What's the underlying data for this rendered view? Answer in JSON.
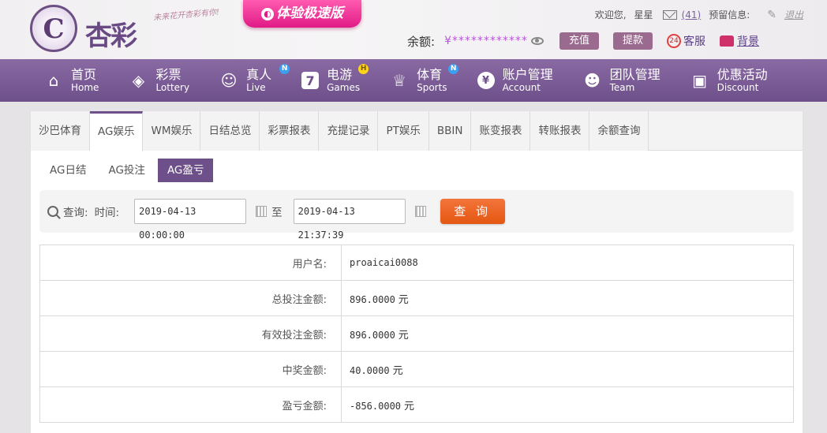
{
  "header": {
    "logo_text": "杏彩",
    "logo_mark": "C",
    "slogan": "未来花开杏彩有你!",
    "trial_badge": "体验极速版",
    "welcome_label": "欢迎您,",
    "username_short": "星星",
    "message_count": "(41)",
    "reserve_label": "预留信息:",
    "logout": "退出",
    "balance_label": "余额:",
    "balance_value": "¥************",
    "deposit": "充值",
    "withdraw": "提款",
    "service": "客服",
    "background": "背景"
  },
  "nav": {
    "items": [
      {
        "cn": "首页",
        "en": "Home",
        "icon": "home-icon"
      },
      {
        "cn": "彩票",
        "en": "Lottery",
        "icon": "lottery-icon"
      },
      {
        "cn": "真人",
        "en": "Live",
        "icon": "live-icon",
        "badge": "N"
      },
      {
        "cn": "电游",
        "en": "Games",
        "icon": "games-icon",
        "badge": "H"
      },
      {
        "cn": "体育",
        "en": "Sports",
        "icon": "sports-icon",
        "badge": "N"
      },
      {
        "cn": "账户管理",
        "en": "Account",
        "icon": "account-icon"
      },
      {
        "cn": "团队管理",
        "en": "Team",
        "icon": "team-icon"
      },
      {
        "cn": "优惠活动",
        "en": "Discount",
        "icon": "gift-icon"
      }
    ]
  },
  "tabs": [
    "沙巴体育",
    "AG娱乐",
    "WM娱乐",
    "日结总览",
    "彩票报表",
    "充提记录",
    "PT娱乐",
    "BBIN",
    "账变报表",
    "转账报表",
    "余额查询"
  ],
  "active_tab": "AG娱乐",
  "subtabs": [
    "AG日结",
    "AG投注",
    "AG盈亏"
  ],
  "active_subtab": "AG盈亏",
  "query": {
    "search_label": "查询:",
    "time_label": "时间:",
    "start": "2019-04-13 00:00:00",
    "to_label": "至",
    "end": "2019-04-13 21:37:39",
    "button": "查 询"
  },
  "result": {
    "rows": [
      {
        "label": "用户名:",
        "value": "proaicai0088",
        "unit": ""
      },
      {
        "label": "总投注金额:",
        "value": "896.0000",
        "unit": "元"
      },
      {
        "label": "有效投注金额:",
        "value": "896.0000",
        "unit": "元"
      },
      {
        "label": "中奖金额:",
        "value": "40.0000",
        "unit": "元"
      },
      {
        "label": "盈亏金额:",
        "value": "-856.0000",
        "unit": "元"
      }
    ]
  },
  "colors": {
    "brand_purple": "#6d4f8a",
    "query_orange": "#e45712",
    "trial_pink": "#e01a86"
  }
}
